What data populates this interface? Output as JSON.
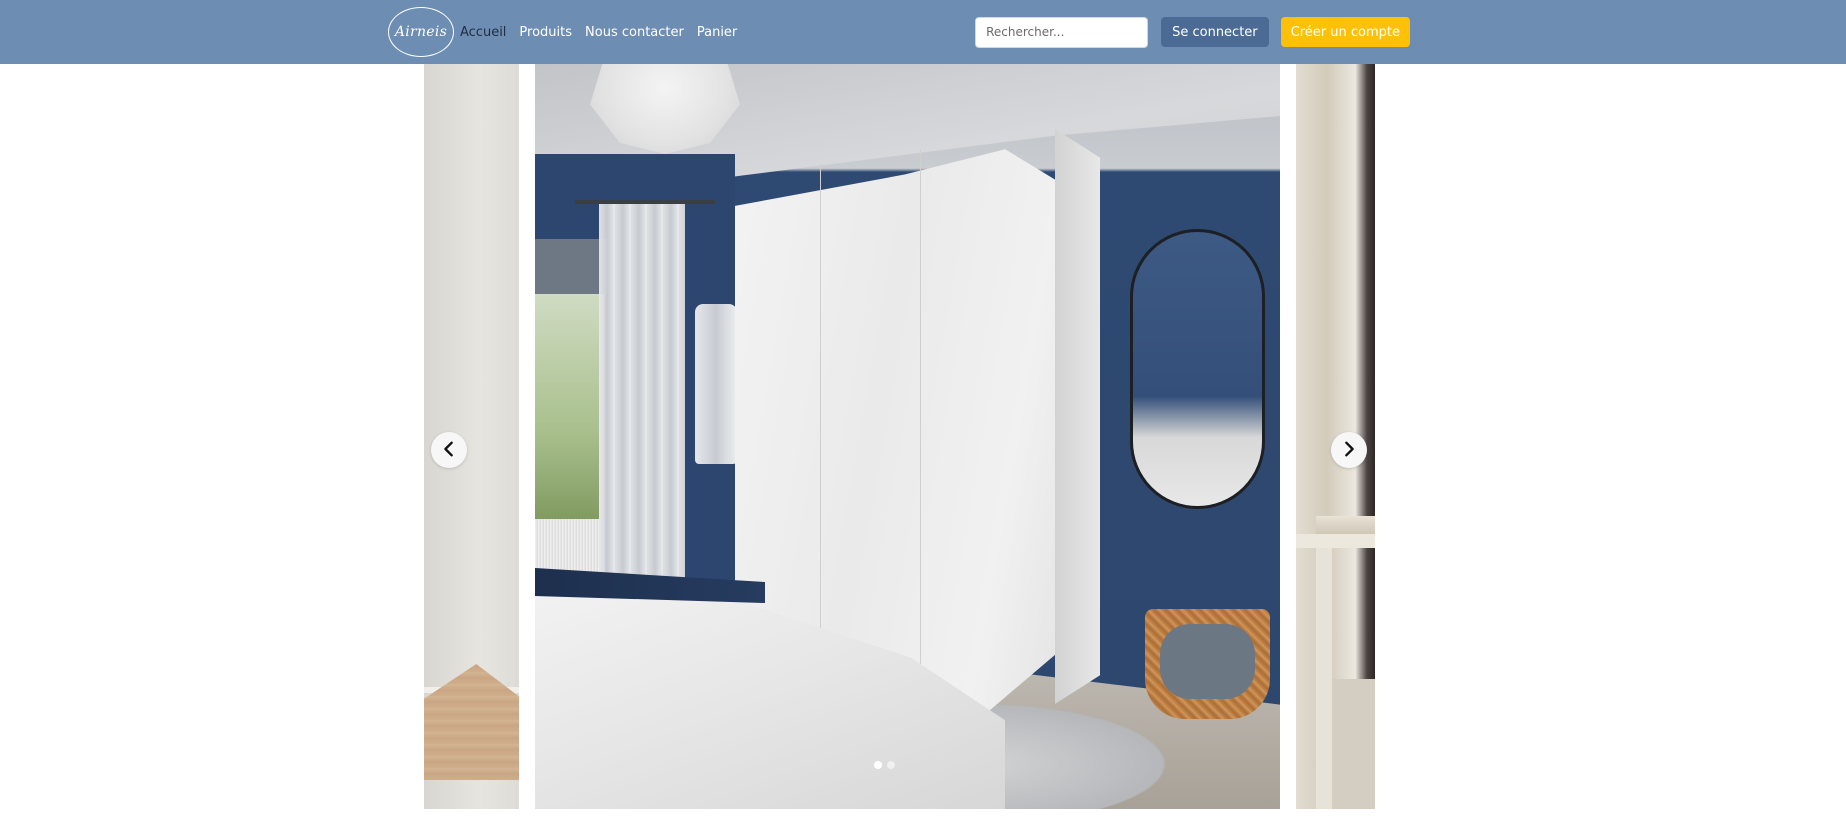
{
  "brand": {
    "logo_text": "Airneis"
  },
  "nav": {
    "links": [
      {
        "label": "Accueil",
        "active": true
      },
      {
        "label": "Produits",
        "active": false
      },
      {
        "label": "Nous contacter",
        "active": false
      },
      {
        "label": "Panier",
        "active": false
      }
    ]
  },
  "search": {
    "placeholder": "Rechercher...",
    "value": ""
  },
  "auth": {
    "login_label": "Se connecter",
    "signup_label": "Créer un compte"
  },
  "carousel": {
    "prev_icon": "chevron-left-icon",
    "next_icon": "chevron-right-icon",
    "slide_count": 2,
    "active_index": 0
  },
  "colors": {
    "navbar": "#6d8db3",
    "login_button": "#4b6b95",
    "signup_button": "#ffc107"
  }
}
